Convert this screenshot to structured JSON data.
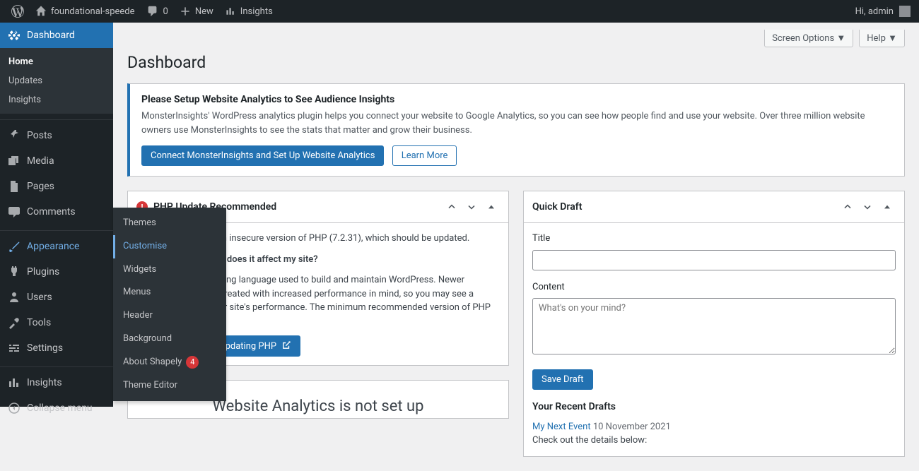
{
  "adminbar": {
    "site_name": "foundational-speede",
    "comments_count": "0",
    "new_label": "New",
    "insights_label": "Insights",
    "greeting": "Hi, admin"
  },
  "sidebar": {
    "dashboard": "Dashboard",
    "dashboard_sub": {
      "home": "Home",
      "updates": "Updates",
      "insights": "Insights"
    },
    "posts": "Posts",
    "media": "Media",
    "pages": "Pages",
    "comments": "Comments",
    "appearance": "Appearance",
    "plugins": "Plugins",
    "users": "Users",
    "tools": "Tools",
    "settings": "Settings",
    "insights": "Insights",
    "collapse": "Collapse menu"
  },
  "appearance_flyout": {
    "themes": "Themes",
    "customise": "Customise",
    "widgets": "Widgets",
    "menus": "Menus",
    "header": "Header",
    "background": "Background",
    "about_shapely": "About Shapely",
    "about_shapely_badge": "4",
    "theme_editor": "Theme Editor"
  },
  "top_buttons": {
    "screen_options": "Screen Options",
    "help": "Help"
  },
  "page_title": "Dashboard",
  "notice": {
    "title": "Please Setup Website Analytics to See Audience Insights",
    "text": "MonsterInsights' WordPress analytics plugin helps you connect your website to Google Analytics, so you can see how people find and use your website. Over three million website owners use MonsterInsights to see the stats that matter and grow their business.",
    "primary_btn": "Connect MonsterInsights and Set Up Website Analytics",
    "secondary_btn": "Learn More"
  },
  "php_box": {
    "title": "PHP Update Recommended",
    "line1": "Your site is running an insecure version of PHP (7.2.31), which should be updated.",
    "heading": "What is PHP and how does it affect my site?",
    "body": "PHP is the programming language used to build and maintain WordPress. Newer versions of PHP are created with increased performance in mind, so you may see a positive effect on your site's performance. The minimum recommended version of PHP is 7.4.",
    "link": "Learn more about updating PHP"
  },
  "analytics_box": {
    "empty_text": "Website Analytics is not set up"
  },
  "quickdraft": {
    "title": "Quick Draft",
    "title_label": "Title",
    "content_label": "Content",
    "content_placeholder": "What's on your mind?",
    "save_btn": "Save Draft",
    "recent_heading": "Your Recent Drafts",
    "draft_link": "My Next Event",
    "draft_date": "10 November 2021",
    "draft_excerpt": "Check out the details below:"
  }
}
